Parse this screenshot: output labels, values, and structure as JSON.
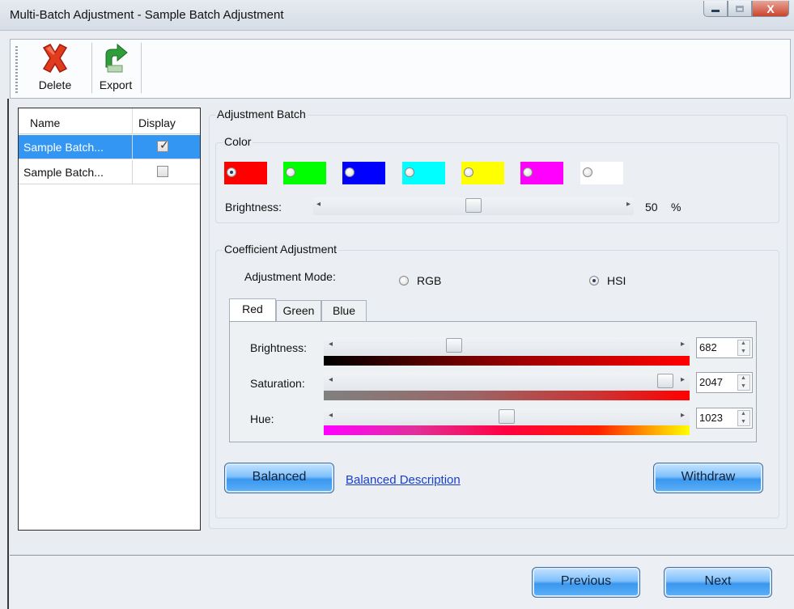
{
  "window": {
    "title": "Multi-Batch Adjustment - Sample Batch Adjustment",
    "close_label": "X"
  },
  "toolbar": {
    "delete_label": "Delete",
    "export_label": "Export"
  },
  "batch_list": {
    "headers": [
      "Name",
      "Display"
    ],
    "rows": [
      {
        "name": "Sample Batch...",
        "display": true,
        "selected": true
      },
      {
        "name": "Sample Batch...",
        "display": false,
        "selected": false
      }
    ]
  },
  "adjustment_batch": {
    "title": "Adjustment Batch",
    "color_group": {
      "title": "Color",
      "swatches": [
        {
          "color": "#ff0000",
          "selected": true
        },
        {
          "color": "#00ff00",
          "selected": false
        },
        {
          "color": "#0000ff",
          "selected": false
        },
        {
          "color": "#00ffff",
          "selected": false
        },
        {
          "color": "#ffff00",
          "selected": false
        },
        {
          "color": "#ff00ff",
          "selected": false
        },
        {
          "color": "#ffffff",
          "selected": false
        }
      ],
      "brightness_label": "Brightness:",
      "brightness_value": "50",
      "brightness_unit": "%",
      "brightness_level": 0.5
    }
  },
  "coefficient": {
    "title": "Coefficient Adjustment",
    "mode_label": "Adjustment Mode:",
    "modes": [
      "RGB",
      "HSI"
    ],
    "selected_mode": "HSI",
    "tabs": [
      "Red",
      "Green",
      "Blue"
    ],
    "active_tab": "Red",
    "sliders": [
      {
        "label": "Brightness:",
        "value": "682",
        "level": 0.333
      },
      {
        "label": "Saturation:",
        "value": "2047",
        "level": 1.0
      },
      {
        "label": "Hue:",
        "value": "1023",
        "level": 0.5
      }
    ],
    "balanced_label": "Balanced",
    "balanced_desc_label": "Balanced Description",
    "withdraw_label": "Withdraw"
  },
  "footer": {
    "previous_label": "Previous",
    "next_label": "Next"
  },
  "colors": {
    "accent_blue": "#3396f2",
    "button_blue": "#5eb1f7",
    "link_blue": "#1a3ecc"
  }
}
